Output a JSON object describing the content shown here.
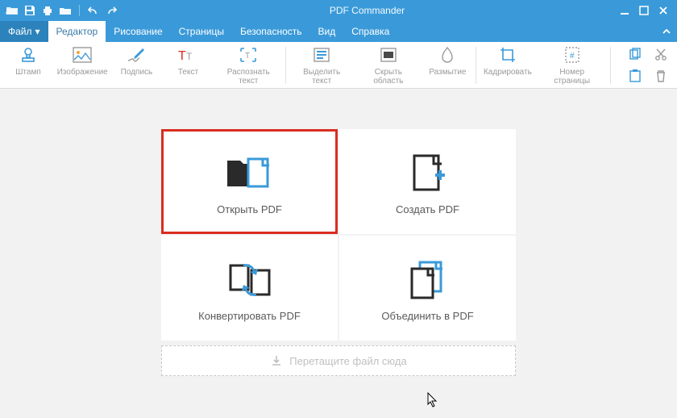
{
  "titlebar": {
    "title": "PDF Commander"
  },
  "menubar": {
    "file": "Файл",
    "items": [
      "Редактор",
      "Рисование",
      "Страницы",
      "Безопасность",
      "Вид",
      "Справка"
    ]
  },
  "toolbar": {
    "stamp": "Штамп",
    "image": "Изображение",
    "signature": "Подпись",
    "text": "Текст",
    "recognize": "Распознать текст",
    "highlight": "Выделить текст",
    "hide": "Скрыть область",
    "blur": "Размытие",
    "crop": "Кадрировать",
    "pagenum": "Номер страницы"
  },
  "cards": {
    "open": "Открыть PDF",
    "create": "Создать PDF",
    "convert": "Конвертировать PDF",
    "merge": "Объединить в PDF"
  },
  "dropzone": {
    "label": "Перетащите файл сюда"
  }
}
